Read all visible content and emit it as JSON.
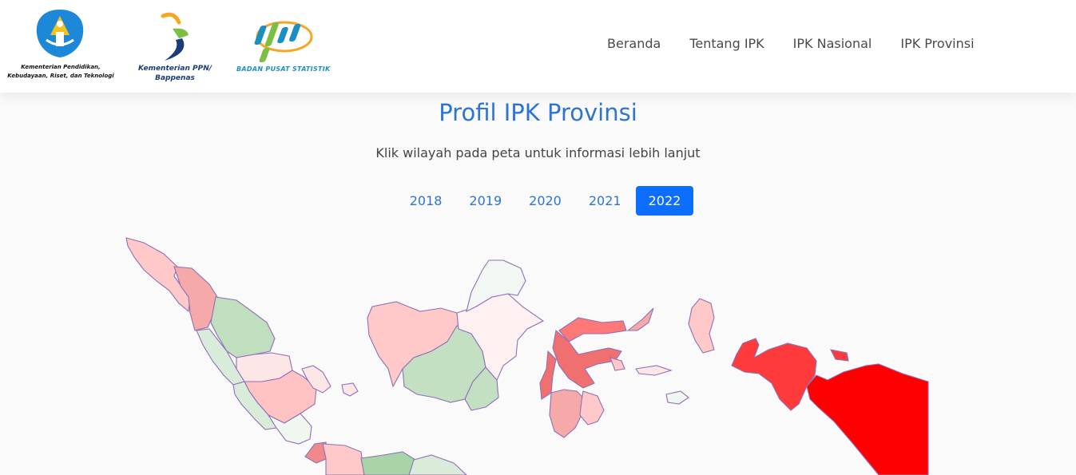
{
  "nav": {
    "logos": {
      "kemdikbud": "Kementerian Pendidikan, Kebudayaan, Riset, dan Teknologi",
      "bappenas": "Kementerian PPN/ Bappenas",
      "bps": "BADAN PUSAT STATISTIK"
    },
    "links": [
      "Beranda",
      "Tentang IPK",
      "IPK Nasional",
      "IPK Provinsi"
    ]
  },
  "page": {
    "title": "Profil IPK Provinsi",
    "subtitle": "Klik wilayah pada peta untuk informasi lebih lanjut"
  },
  "years": {
    "options": [
      "2018",
      "2019",
      "2020",
      "2021",
      "2022"
    ],
    "selected": "2022"
  },
  "colors": {
    "accent": "#0d6efd",
    "title": "#2e74d2",
    "high_red": "#ff0000",
    "green": "#c3e0c3",
    "pink": "#ffc9c9"
  }
}
